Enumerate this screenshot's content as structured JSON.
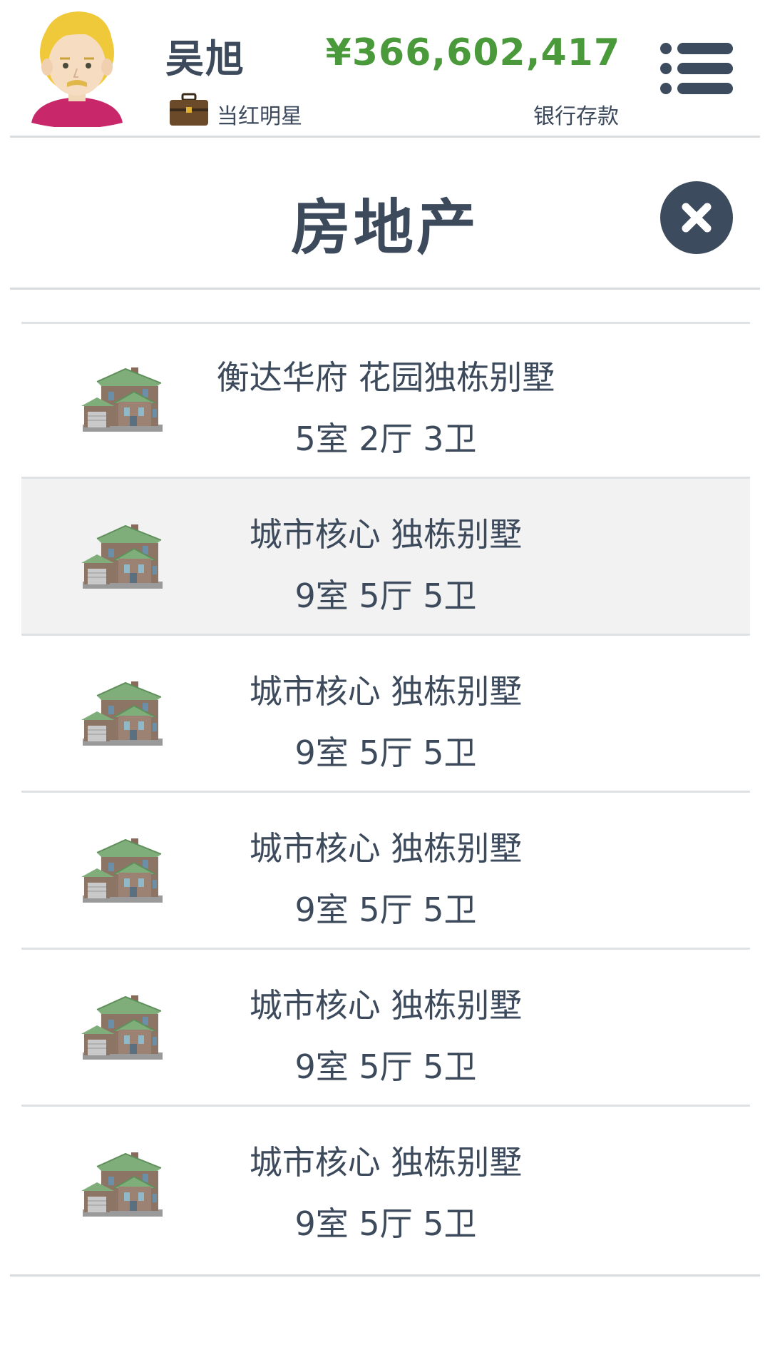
{
  "player": {
    "name": "吴旭",
    "job_title": "当红明星",
    "money": "¥366,602,417",
    "money_label": "银行存款"
  },
  "panel": {
    "title": "房地产"
  },
  "icons": {
    "avatar": "blonde-man-avatar",
    "job": "briefcase-icon",
    "menu": "menu-list-icon",
    "close": "close-icon",
    "house": "house-icon"
  },
  "colors": {
    "money": "#4a9a3c",
    "text": "#3c4a5c",
    "close_bg": "#3d4b5e",
    "selected_row": "#f2f2f2"
  },
  "properties": [
    {
      "name": "衡达华府 花园独栋别墅",
      "rooms": "5室 2厅 3卫"
    },
    {
      "name": "城市核心 独栋别墅",
      "rooms": "9室 5厅 5卫"
    },
    {
      "name": "城市核心 独栋别墅",
      "rooms": "9室 5厅 5卫"
    },
    {
      "name": "城市核心 独栋别墅",
      "rooms": "9室 5厅 5卫"
    },
    {
      "name": "城市核心 独栋别墅",
      "rooms": "9室 5厅 5卫"
    },
    {
      "name": "城市核心 独栋别墅",
      "rooms": "9室 5厅 5卫"
    }
  ]
}
